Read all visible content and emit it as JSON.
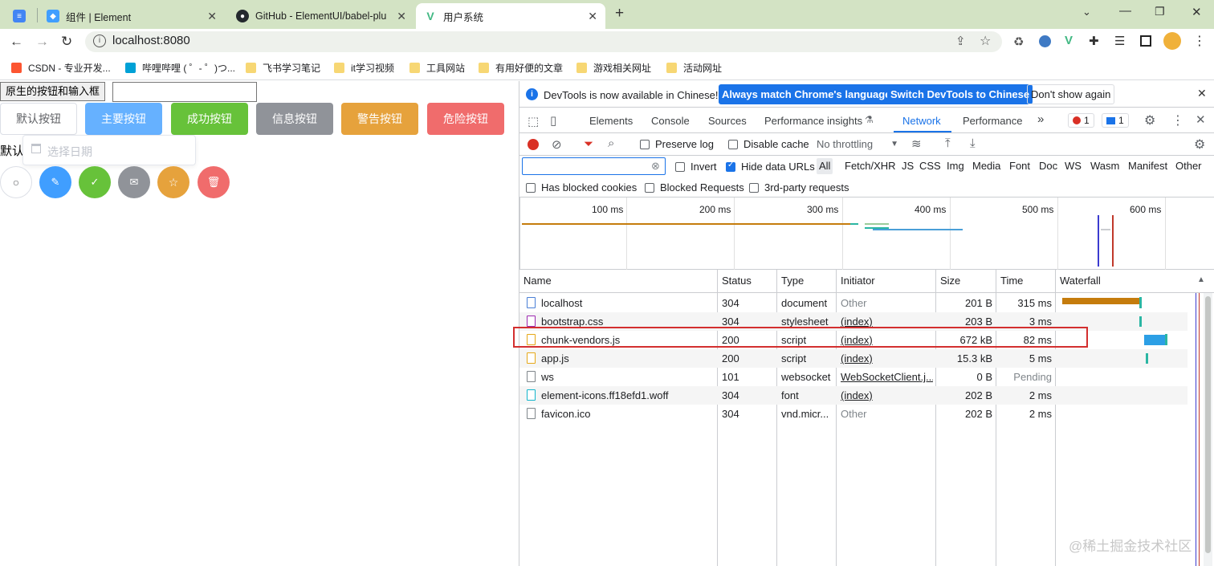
{
  "browser": {
    "tabs": [
      {
        "label": "",
        "icon": "docs-icon",
        "color": "#4285f4"
      },
      {
        "label": "组件 | Element",
        "icon": "element-icon",
        "color": "#409eff"
      },
      {
        "label": "GitHub - ElementUI/babel-plu",
        "icon": "github-icon",
        "color": "#24292e"
      },
      {
        "label": "用户系统",
        "icon": "vue-icon",
        "color": "#41b883"
      }
    ],
    "url": "localhost:8080",
    "bookmarks": [
      {
        "label": "CSDN - 专业开发...",
        "color": "#fc5531"
      },
      {
        "label": "哔哩哔哩 ( ゜- ゜)つ...",
        "color": "#00a1d6"
      },
      {
        "label": "飞书学习笔记",
        "color": "#f7d774"
      },
      {
        "label": "it学习视频",
        "color": "#f7d774"
      },
      {
        "label": "工具网站",
        "color": "#f7d774"
      },
      {
        "label": "有用好便的文章",
        "color": "#f7d774"
      },
      {
        "label": "游戏相关网址",
        "color": "#f7d774"
      },
      {
        "label": "活动网址",
        "color": "#f7d774"
      }
    ]
  },
  "page": {
    "native_button": "原生的按钮和输入框",
    "buttons": [
      {
        "label": "默认按钮",
        "color": "#ffffff"
      },
      {
        "label": "主要按钮",
        "color": "#66b1ff"
      },
      {
        "label": "成功按钮",
        "color": "#67c23a"
      },
      {
        "label": "信息按钮",
        "color": "#909399"
      },
      {
        "label": "警告按钮",
        "color": "#e6a23c"
      },
      {
        "label": "危险按钮",
        "color": "#f06c6c"
      }
    ],
    "default_label": "默认",
    "date_placeholder": "选择日期",
    "circle_buttons": [
      {
        "icon": "search-icon",
        "color": "#ffffff"
      },
      {
        "icon": "edit-icon",
        "color": "#409eff"
      },
      {
        "icon": "check-icon",
        "color": "#67c23a"
      },
      {
        "icon": "message-icon",
        "color": "#909399"
      },
      {
        "icon": "star-icon",
        "color": "#e6a23c"
      },
      {
        "icon": "delete-icon",
        "color": "#f06c6c"
      }
    ]
  },
  "devtools": {
    "info": "DevTools is now available in Chinese!",
    "match_lang": "Always match Chrome's language",
    "switch_lang": "Switch DevTools to Chinese",
    "dont_show": "Don't show again",
    "tabs": [
      "Elements",
      "Console",
      "Sources",
      "Performance insights",
      "Network",
      "Performance",
      "»"
    ],
    "error_count": "1",
    "message_count": "1",
    "preserve_log": "Preserve log",
    "disable_cache": "Disable cache",
    "throttling": "No throttling",
    "invert": "Invert",
    "hide_data_urls": "Hide data URLs",
    "filters": [
      "All",
      "Fetch/XHR",
      "JS",
      "CSS",
      "Img",
      "Media",
      "Font",
      "Doc",
      "WS",
      "Wasm",
      "Manifest",
      "Other"
    ],
    "has_blocked_cookies": "Has blocked cookies",
    "blocked_requests": "Blocked Requests",
    "third_party": "3rd-party requests",
    "timeline_ticks": [
      "100 ms",
      "200 ms",
      "300 ms",
      "400 ms",
      "500 ms",
      "600 ms"
    ],
    "columns": [
      "Name",
      "Status",
      "Type",
      "Initiator",
      "Size",
      "Time",
      "Waterfall"
    ],
    "rows": [
      {
        "name": "localhost",
        "status": "304",
        "type": "document",
        "initiator": "Other",
        "size": "201 B",
        "time": "315 ms",
        "icon_color": "#4a7fd6"
      },
      {
        "name": "bootstrap.css",
        "status": "304",
        "type": "stylesheet",
        "initiator": "(index)",
        "size": "203 B",
        "time": "3 ms",
        "icon_color": "#9c27b0"
      },
      {
        "name": "chunk-vendors.js",
        "status": "200",
        "type": "script",
        "initiator": "(index)",
        "size": "672 kB",
        "time": "82 ms",
        "icon_color": "#e6a817"
      },
      {
        "name": "app.js",
        "status": "200",
        "type": "script",
        "initiator": "(index)",
        "size": "15.3 kB",
        "time": "5 ms",
        "icon_color": "#e6a817"
      },
      {
        "name": "ws",
        "status": "101",
        "type": "websocket",
        "initiator": "WebSocketClient.j...",
        "size": "0 B",
        "time": "Pending",
        "icon_color": "#80868b"
      },
      {
        "name": "element-icons.ff18efd1.woff",
        "status": "304",
        "type": "font",
        "initiator": "(index)",
        "size": "202 B",
        "time": "2 ms",
        "icon_color": "#12b5cb"
      },
      {
        "name": "favicon.ico",
        "status": "304",
        "type": "vnd.micr...",
        "initiator": "Other",
        "size": "202 B",
        "time": "2 ms",
        "icon_color": "#80868b"
      }
    ],
    "highlight_color": "#d32f2f"
  },
  "watermark": "@稀土掘金技术社区"
}
